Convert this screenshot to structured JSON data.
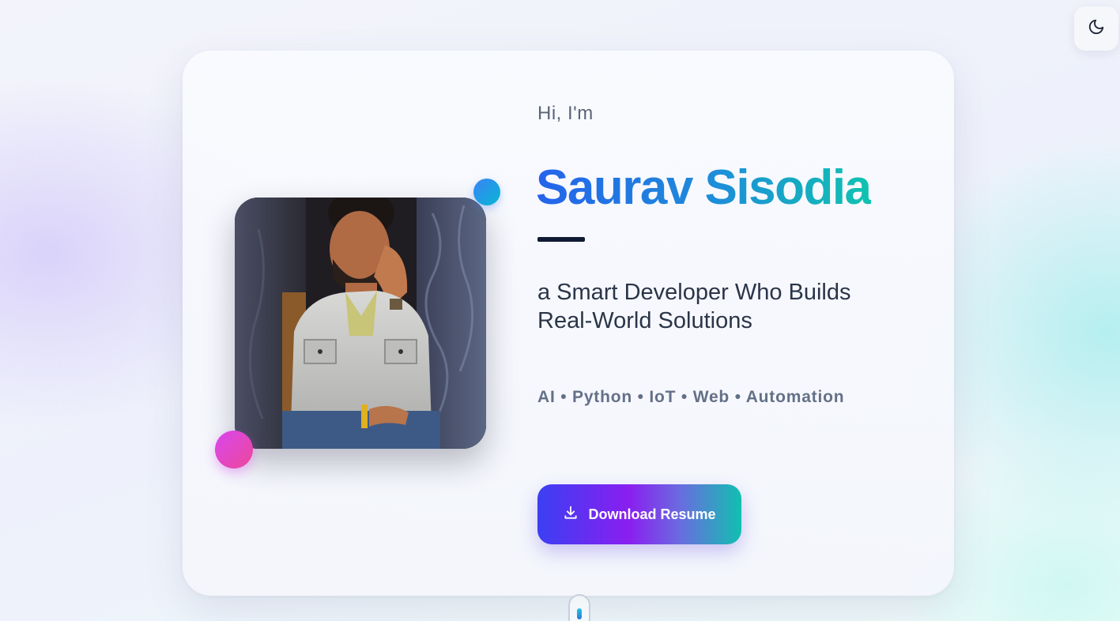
{
  "theme_toggle": {
    "icon": "moon-icon"
  },
  "hero": {
    "greeting": "Hi, I'm",
    "name": "Saurav Sisodia",
    "tagline": "a Smart Developer Who Builds Real-World Solutions",
    "skills": "AI • Python • IoT • Web • Automation",
    "download_button": {
      "label": "Download Resume",
      "icon": "download-icon"
    },
    "photo": {
      "alt": "Saurav Sisodia portrait"
    }
  },
  "colors": {
    "name_gradient_start": "#2563eb",
    "name_gradient_end": "#10c3b0",
    "button_gradient_start": "#3b3ff2",
    "button_gradient_mid": "#8a1ff0",
    "button_gradient_end": "#11c0b0",
    "accent_dot_blue": "#3b82f6",
    "accent_dot_pink": "#d946ef"
  },
  "scroll_indicator": {
    "icon": "mouse-scroll-icon"
  }
}
